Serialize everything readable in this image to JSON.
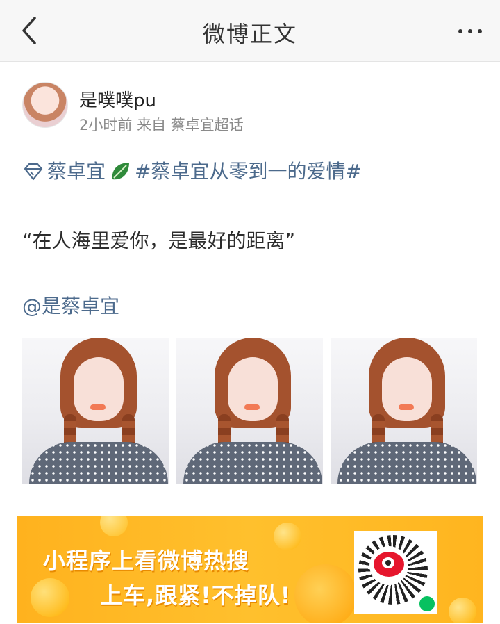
{
  "nav": {
    "title": "微博正文"
  },
  "post": {
    "author": "是噗噗pu",
    "time": "2小时前",
    "from_prefix": "来自",
    "source": "蔡卓宜超话",
    "tag_topic": "蔡卓宜",
    "hashtag": "#蔡卓宜从零到一的爱情#",
    "quote": "“在人海里爱你，是最好的距离”",
    "mention": "@是蔡卓宜"
  },
  "banner": {
    "line1": "小程序上看微博热搜",
    "line2": "上车,跟紧!不掉队!"
  },
  "colors": {
    "link": "#4c6a8c",
    "banner_bg": "#ffb21e",
    "weibo_red": "#e6162d"
  },
  "icons": [
    "back-chevron-icon",
    "more-dots-icon",
    "diamond-icon",
    "leaf-emoji-icon",
    "qr-code-icon"
  ]
}
